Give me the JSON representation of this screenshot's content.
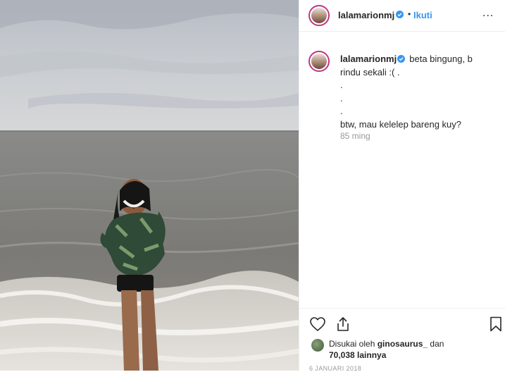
{
  "post": {
    "username": "lalamarionmj",
    "dot": "•",
    "follow_label": "Ikuti",
    "more_label": "...",
    "caption_lines": [
      "beta bingung, b",
      "rindu sekali :( .",
      ".",
      ".",
      ".",
      "btw, mau kelelep bareng kuy?"
    ],
    "time_ago": "85 ming",
    "liked_prefix": "Disukai oleh",
    "liked_user": "ginosaurus_",
    "liked_and": "dan",
    "likes_count": "70,038 lainnya",
    "date": "6 JANUARI 2018"
  },
  "colors": {
    "link_blue": "#3897f0",
    "verified_blue": "#3897f0",
    "ring": "#c13584",
    "muted": "#999999",
    "text": "#262626"
  },
  "icons": {
    "verified": "verified-badge-icon",
    "like": "heart-outline-icon",
    "share": "share-arrow-icon",
    "save": "bookmark-outline-icon",
    "more": "more-dots-icon"
  }
}
